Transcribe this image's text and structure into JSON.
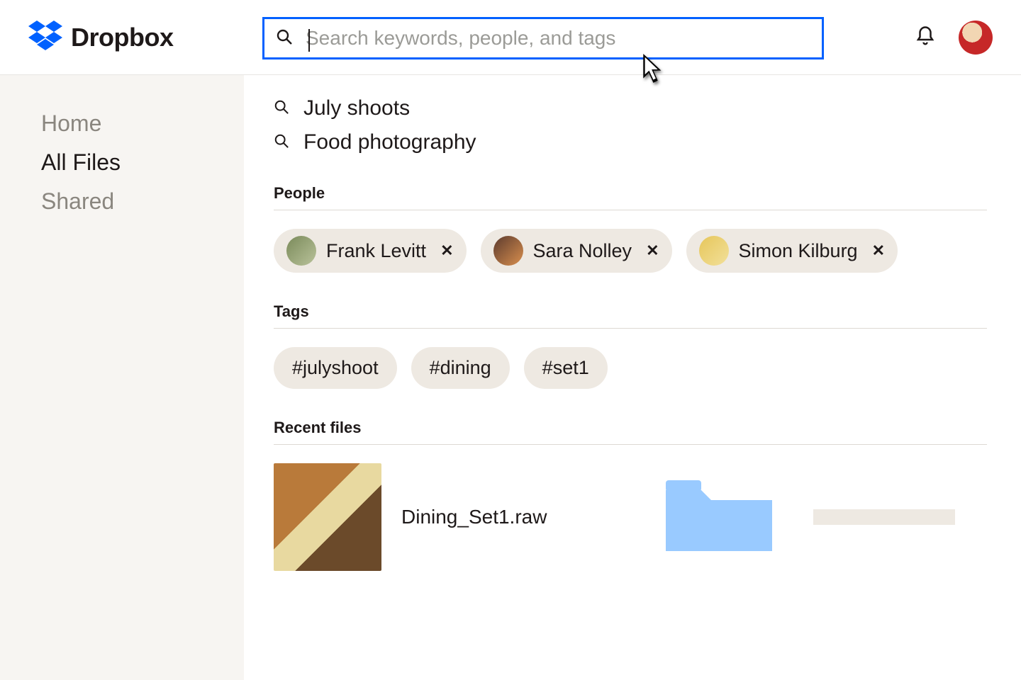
{
  "brand": {
    "name": "Dropbox"
  },
  "search": {
    "placeholder": "Search keywords, people, and tags",
    "value": ""
  },
  "sidebar": {
    "items": [
      {
        "label": "Home",
        "active": false
      },
      {
        "label": "All Files",
        "active": true
      },
      {
        "label": "Shared",
        "active": false
      }
    ]
  },
  "suggestions": [
    {
      "label": "July shoots"
    },
    {
      "label": "Food photography"
    }
  ],
  "sections": {
    "people_header": "People",
    "tags_header": "Tags",
    "recent_header": "Recent files"
  },
  "people": [
    {
      "name": "Frank Levitt"
    },
    {
      "name": "Sara Nolley"
    },
    {
      "name": "Simon Kilburg"
    }
  ],
  "tags": [
    {
      "label": "#julyshoot"
    },
    {
      "label": "#dining"
    },
    {
      "label": "#set1"
    }
  ],
  "recent": {
    "file_name": "Dining_Set1.raw"
  }
}
